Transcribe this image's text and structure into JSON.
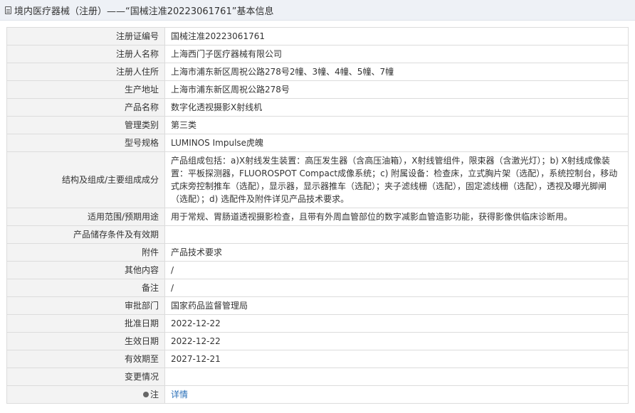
{
  "header": {
    "icon": "document-icon",
    "title": "境内医疗器械（注册）——“国械注准20223061761”基本信息"
  },
  "rows": [
    {
      "label": "注册证编号",
      "value": "国械注准20223061761"
    },
    {
      "label": "注册人名称",
      "value": "上海西门子医疗器械有限公司"
    },
    {
      "label": "注册人住所",
      "value": "上海市浦东新区周祝公路278号2幢、3幢、4幢、5幢、7幢"
    },
    {
      "label": "生产地址",
      "value": "上海市浦东新区周祝公路278号"
    },
    {
      "label": "产品名称",
      "value": "数字化透视摄影X射线机"
    },
    {
      "label": "管理类别",
      "value": "第三类"
    },
    {
      "label": "型号规格",
      "value": "LUMINOS Impulse虎魄"
    },
    {
      "label": "结构及组成/主要组成成分",
      "value": "产品组成包括：a)X射线发生装置：高压发生器（含高压油箱），X射线管组件，限束器（含激光灯）；b) X射线成像装置：平板探测器，FLUOROSPOT Compact成像系统；c) 附属设备：检查床，立式胸片架（选配），系统控制台，移动式床旁控制推车（选配），显示器，显示器推车（选配）；夹子滤线栅（选配），固定滤线栅（选配），透视及曝光脚闸（选配）；d) 选配件及附件详见产品技术要求。"
    },
    {
      "label": "适用范围/预期用途",
      "value": "用于常规、胃肠道透视摄影检查，且带有外周血管部位的数字减影血管造影功能，获得影像供临床诊断用。"
    },
    {
      "label": "产品储存条件及有效期",
      "value": ""
    },
    {
      "label": "附件",
      "value": "产品技术要求"
    },
    {
      "label": "其他内容",
      "value": "/"
    },
    {
      "label": "备注",
      "value": "/"
    },
    {
      "label": "审批部门",
      "value": "国家药品监督管理局"
    },
    {
      "label": "批准日期",
      "value": "2022-12-22"
    },
    {
      "label": "生效日期",
      "value": "2022-12-22"
    },
    {
      "label": "有效期至",
      "value": "2027-12-21"
    },
    {
      "label": "变更情况",
      "value": ""
    },
    {
      "label": "注",
      "value": "详情"
    }
  ]
}
